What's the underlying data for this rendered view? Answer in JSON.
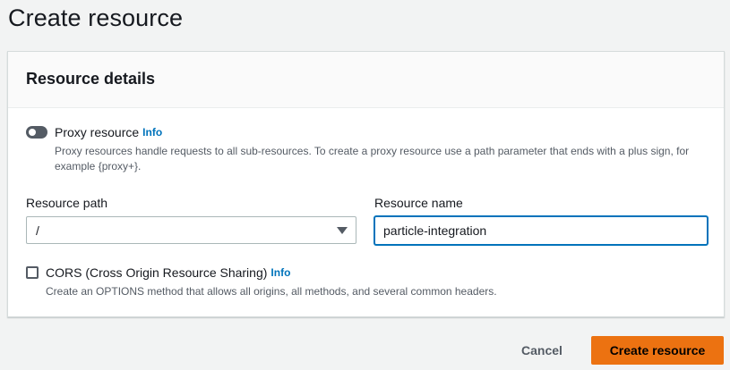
{
  "page": {
    "title": "Create resource"
  },
  "container": {
    "title": "Resource details"
  },
  "proxy": {
    "label": "Proxy resource",
    "info": "Info",
    "description": "Proxy resources handle requests to all sub-resources. To create a proxy resource use a path parameter that ends with a plus sign, for example {proxy+}.",
    "enabled": false
  },
  "resource_path": {
    "label": "Resource path",
    "value": "/"
  },
  "resource_name": {
    "label": "Resource name",
    "value": "particle-integration"
  },
  "cors": {
    "label": "CORS (Cross Origin Resource Sharing)",
    "info": "Info",
    "description": "Create an OPTIONS method that allows all origins, all methods, and several common headers.",
    "checked": false
  },
  "actions": {
    "cancel_label": "Cancel",
    "create_label": "Create resource"
  },
  "colors": {
    "accent": "#ec7211",
    "link": "#0073bb",
    "focus": "#0073bb"
  },
  "icons": {
    "toggle": "toggle-off-icon",
    "select_caret": "caret-down-icon",
    "checkbox": "checkbox-unchecked-icon"
  }
}
